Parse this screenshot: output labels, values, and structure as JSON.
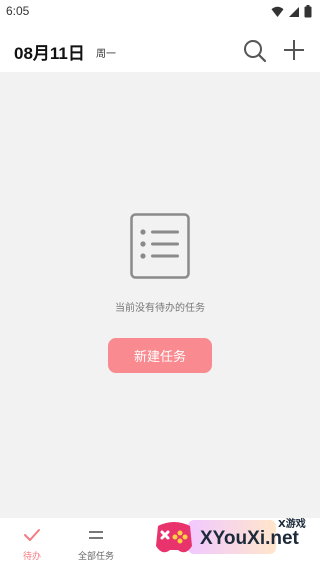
{
  "status_bar": {
    "time": "6:05"
  },
  "header": {
    "date": "08月11日",
    "weekday": "周一"
  },
  "empty_state": {
    "message": "当前没有待办的任务",
    "button_label": "新建任务"
  },
  "bottom_nav": [
    {
      "label": "待办",
      "active": true
    },
    {
      "label": "全部任务",
      "active": false
    }
  ],
  "watermark": {
    "brand": "XYouXi.net",
    "tag": "X游戏"
  },
  "colors": {
    "accent": "#f98b90",
    "content_bg": "#f2f2f2",
    "icon_gray": "#8a8a8a",
    "active_nav": "#f47a80"
  }
}
